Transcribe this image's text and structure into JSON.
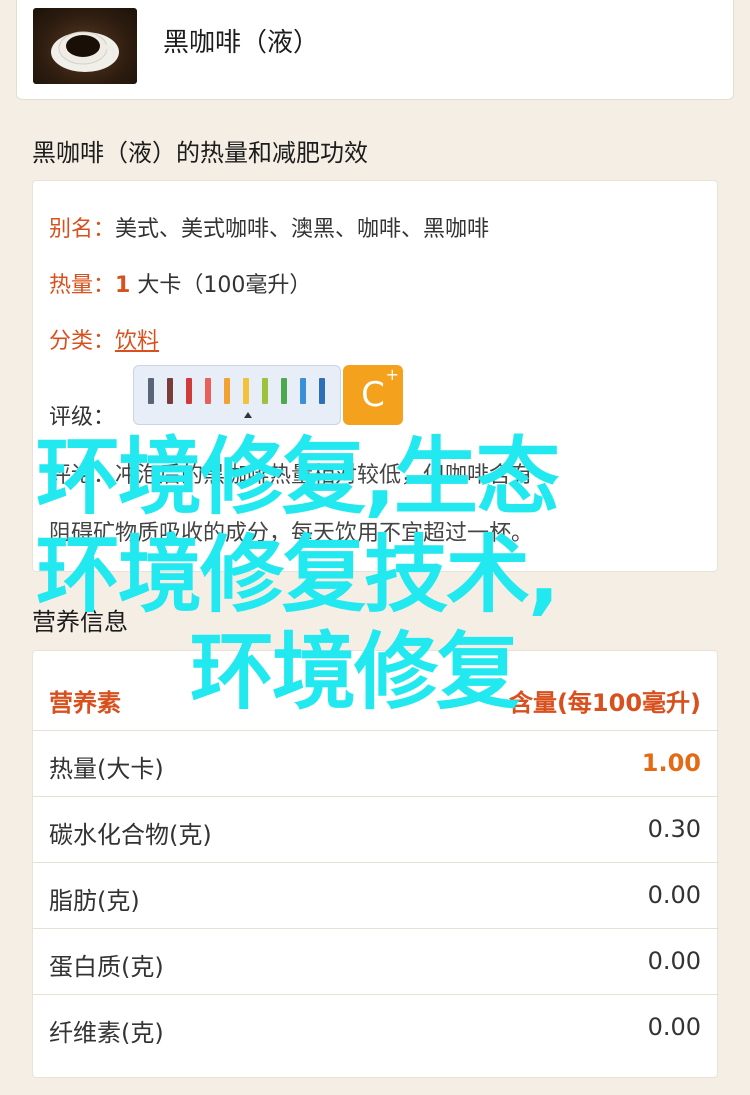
{
  "header": {
    "product_name": "黑咖啡（液）",
    "thumb_icon": "coffee-cup-icon"
  },
  "info_section": {
    "title": "黑咖啡（液）的热量和减肥功效",
    "alias_label": "别名：",
    "alias_value": "美式、美式咖啡、澳黑、咖啡、黑咖啡",
    "calorie_label": "热量：",
    "calorie_number": "1",
    "calorie_unit": " 大卡（100毫升）",
    "category_label": "分类：",
    "category_value": "饮料",
    "rating_label": "评级：",
    "rating_grade": "C",
    "rating_plus": "+",
    "rating_bar_colors": [
      "#5a6678",
      "#7a3b3b",
      "#d03a3a",
      "#e8605a",
      "#f2a233",
      "#f4c23a",
      "#9ec33a",
      "#4ea84e",
      "#3b8fd8",
      "#2e6fb8"
    ],
    "review_text": "评论：冲泡后的黑咖啡热量相对较低，但咖啡含有",
    "review_text_2": "阻碍矿物质吸收的成分，每天饮用不宜超过一杯。"
  },
  "nutrition_section": {
    "title": "营养信息",
    "header_name": "营养素",
    "header_value": "含量(每100毫升)",
    "rows": [
      {
        "name": "热量(大卡)",
        "value": "1.00"
      },
      {
        "name": "碳水化合物(克)",
        "value": "0.30"
      },
      {
        "name": "脂肪(克)",
        "value": "0.00"
      },
      {
        "name": "蛋白质(克)",
        "value": "0.00"
      },
      {
        "name": "纤维素(克)",
        "value": "0.00"
      }
    ]
  },
  "overlay": {
    "line1": "环境修复,生态",
    "line2": "环境修复技术,",
    "line3": "环境修复",
    "color": "#22e8f0"
  }
}
